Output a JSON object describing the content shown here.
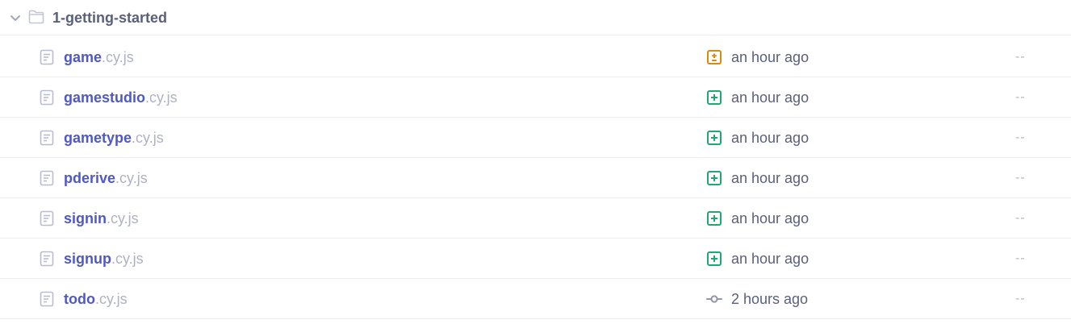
{
  "folder": {
    "name": "1-getting-started",
    "icon": "folder-icon",
    "chevron": "chevron-down-icon"
  },
  "files": [
    {
      "base": "game",
      "ext": ".cy.js",
      "status": "modified",
      "status_icon": "file-modified-icon",
      "time": "an hour ago",
      "duration": "--"
    },
    {
      "base": "gamestudio",
      "ext": ".cy.js",
      "status": "added",
      "status_icon": "file-added-icon",
      "time": "an hour ago",
      "duration": "--"
    },
    {
      "base": "gametype",
      "ext": ".cy.js",
      "status": "added",
      "status_icon": "file-added-icon",
      "time": "an hour ago",
      "duration": "--"
    },
    {
      "base": "pderive",
      "ext": ".cy.js",
      "status": "added",
      "status_icon": "file-added-icon",
      "time": "an hour ago",
      "duration": "--"
    },
    {
      "base": "signin",
      "ext": ".cy.js",
      "status": "added",
      "status_icon": "file-added-icon",
      "time": "an hour ago",
      "duration": "--"
    },
    {
      "base": "signup",
      "ext": ".cy.js",
      "status": "added",
      "status_icon": "file-added-icon",
      "time": "an hour ago",
      "duration": "--"
    },
    {
      "base": "todo",
      "ext": ".cy.js",
      "status": "committed",
      "status_icon": "commit-icon",
      "time": "2 hours ago",
      "duration": "--"
    }
  ],
  "colors": {
    "modified": "#dc8a0e",
    "added": "#1fa971",
    "committed": "#9095ad",
    "file_link": "#4f58c8",
    "file_ext": "#aeb2c3",
    "text": "#5a5f7a",
    "border": "#eceef3"
  }
}
